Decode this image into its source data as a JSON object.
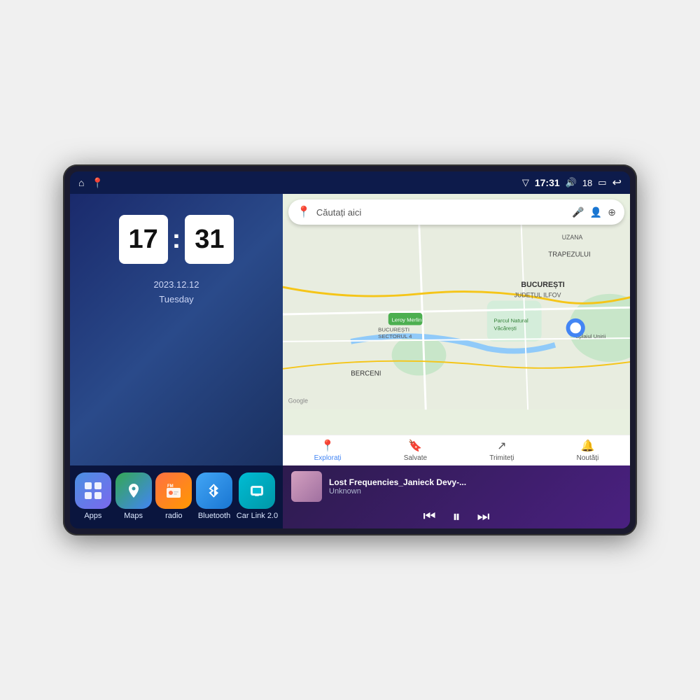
{
  "device": {
    "status_bar": {
      "left_icons": [
        "home",
        "maps"
      ],
      "time": "17:31",
      "signal": "▽",
      "volume": "🔊",
      "battery": "18",
      "battery_icon": "🔋",
      "back": "↩"
    },
    "clock": {
      "hours": "17",
      "minutes": "31",
      "date": "2023.12.12",
      "day": "Tuesday"
    },
    "map": {
      "search_placeholder": "Căutați aici",
      "location": "București",
      "nav_items": [
        {
          "label": "Explorați",
          "icon": "📍",
          "active": true
        },
        {
          "label": "Salvate",
          "icon": "🔖",
          "active": false
        },
        {
          "label": "Trimiteți",
          "icon": "↗",
          "active": false
        },
        {
          "label": "Noutăți",
          "icon": "🔔",
          "active": false
        }
      ]
    },
    "apps": [
      {
        "id": "apps",
        "label": "Apps",
        "icon": "⊞",
        "class": "icon-apps"
      },
      {
        "id": "maps",
        "label": "Maps",
        "icon": "📍",
        "class": "icon-maps"
      },
      {
        "id": "radio",
        "label": "radio",
        "icon": "📻",
        "class": "icon-radio"
      },
      {
        "id": "bluetooth",
        "label": "Bluetooth",
        "icon": "⬡",
        "class": "icon-bluetooth"
      },
      {
        "id": "carlink",
        "label": "Car Link 2.0",
        "icon": "📱",
        "class": "icon-carlink"
      }
    ],
    "music": {
      "title": "Lost Frequencies_Janieck Devy-...",
      "artist": "Unknown",
      "controls": {
        "prev": "⏮",
        "play": "⏸",
        "next": "⏭"
      }
    }
  }
}
